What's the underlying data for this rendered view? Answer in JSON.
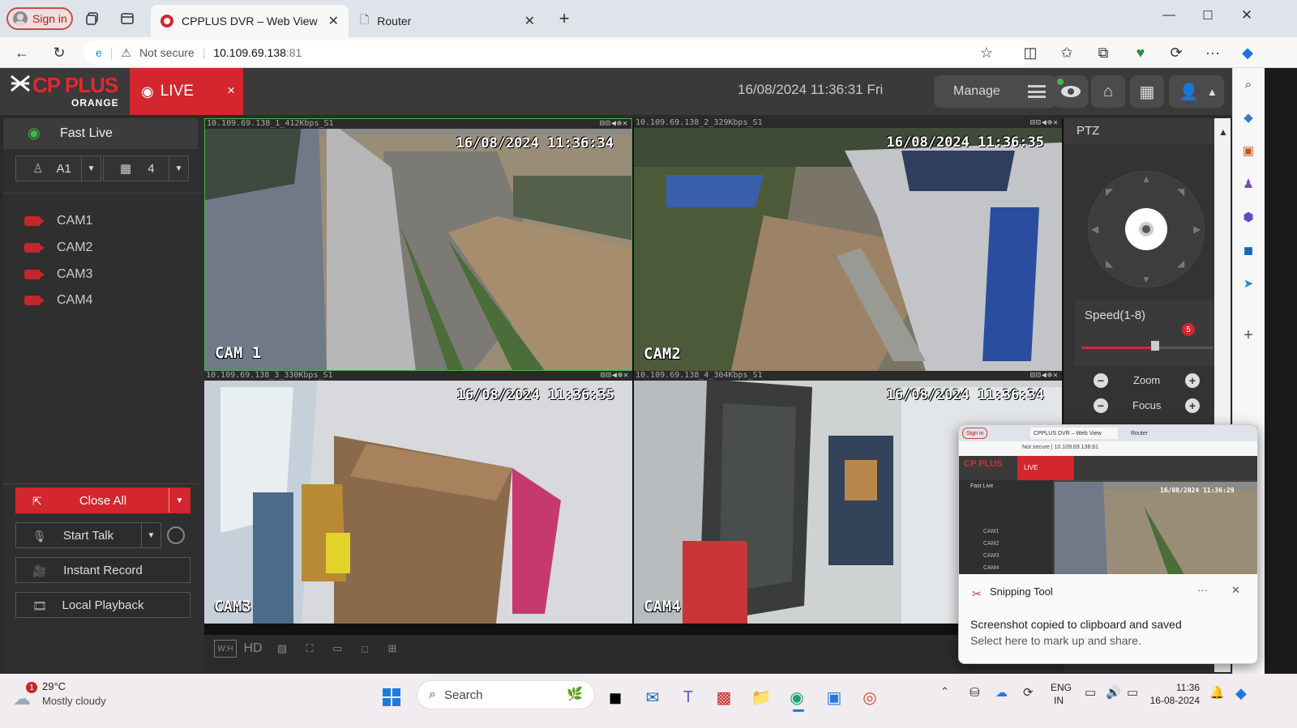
{
  "browser": {
    "signin_label": "Sign in",
    "tabs": [
      {
        "title": "CPPLUS DVR – Web View",
        "active": true
      },
      {
        "title": "Router",
        "active": false
      }
    ],
    "address": {
      "security": "Not secure",
      "host": "10.109.69.138",
      "port": ":81"
    }
  },
  "dvr": {
    "logo_text": "CP PLUS",
    "logo_sub": "ORANGE",
    "live_label": "LIVE",
    "live_close": "×",
    "datetime": "16/08/2024 11:36:31 Fri",
    "manage_label": "Manage",
    "fast_live": "Fast Live",
    "channel_select": "A1",
    "layout_select": "4",
    "cameras": [
      "CAM1",
      "CAM2",
      "CAM3",
      "CAM4"
    ],
    "buttons": {
      "close_all": "Close All",
      "start_talk": "Start Talk",
      "instant_record": "Instant Record",
      "local_playback": "Local Playback"
    },
    "tiles": [
      {
        "info": "10.109.69.138_1_412Kbps_S1",
        "timestamp": "16/08/2024 11:36:34",
        "label": "CAM 1"
      },
      {
        "info": "10.109.69.138_2_329Kbps_S1",
        "timestamp": "16/08/2024 11:36:35",
        "label": "CAM2"
      },
      {
        "info": "10.109.69.138_3_330Kbps_S1",
        "timestamp": "16/08/2024 11:36:35",
        "label": "CAM3"
      },
      {
        "info": "10.109.69.138_4_304Kbps_S1",
        "timestamp": "16/08/2024 11:36:34",
        "label": "CAM4"
      }
    ],
    "toolbar_hd": "HD",
    "toolbar_wh": "W:H",
    "ptz": {
      "title": "PTZ",
      "speed_label": "Speed(1-8)",
      "speed_value": "5",
      "speed_fraction": 0.56,
      "zoom_label": "Zoom",
      "focus_label": "Focus"
    }
  },
  "snipping": {
    "title": "Snipping Tool",
    "more": "···",
    "close": "✕",
    "message": "Screenshot copied to clipboard and saved",
    "sub": "Select here to mark up and share.",
    "thumb_tabs": [
      "Sign in",
      "CPPLUS DVR – Web View",
      "Router"
    ],
    "thumb_url": "10.109.69.138:81",
    "thumb_security": "Not secure",
    "thumb_live": "LIVE",
    "thumb_fast_live": "Fast Live",
    "thumb_timestamp": "16/08/2024 11:36:29"
  },
  "taskbar": {
    "weather_temp": "29°C",
    "weather_desc": "Mostly cloudy",
    "weather_badge": "1",
    "search_placeholder": "Search",
    "lang_top": "ENG",
    "lang_bottom": "IN",
    "time": "11:36",
    "date": "16-08-2024"
  }
}
